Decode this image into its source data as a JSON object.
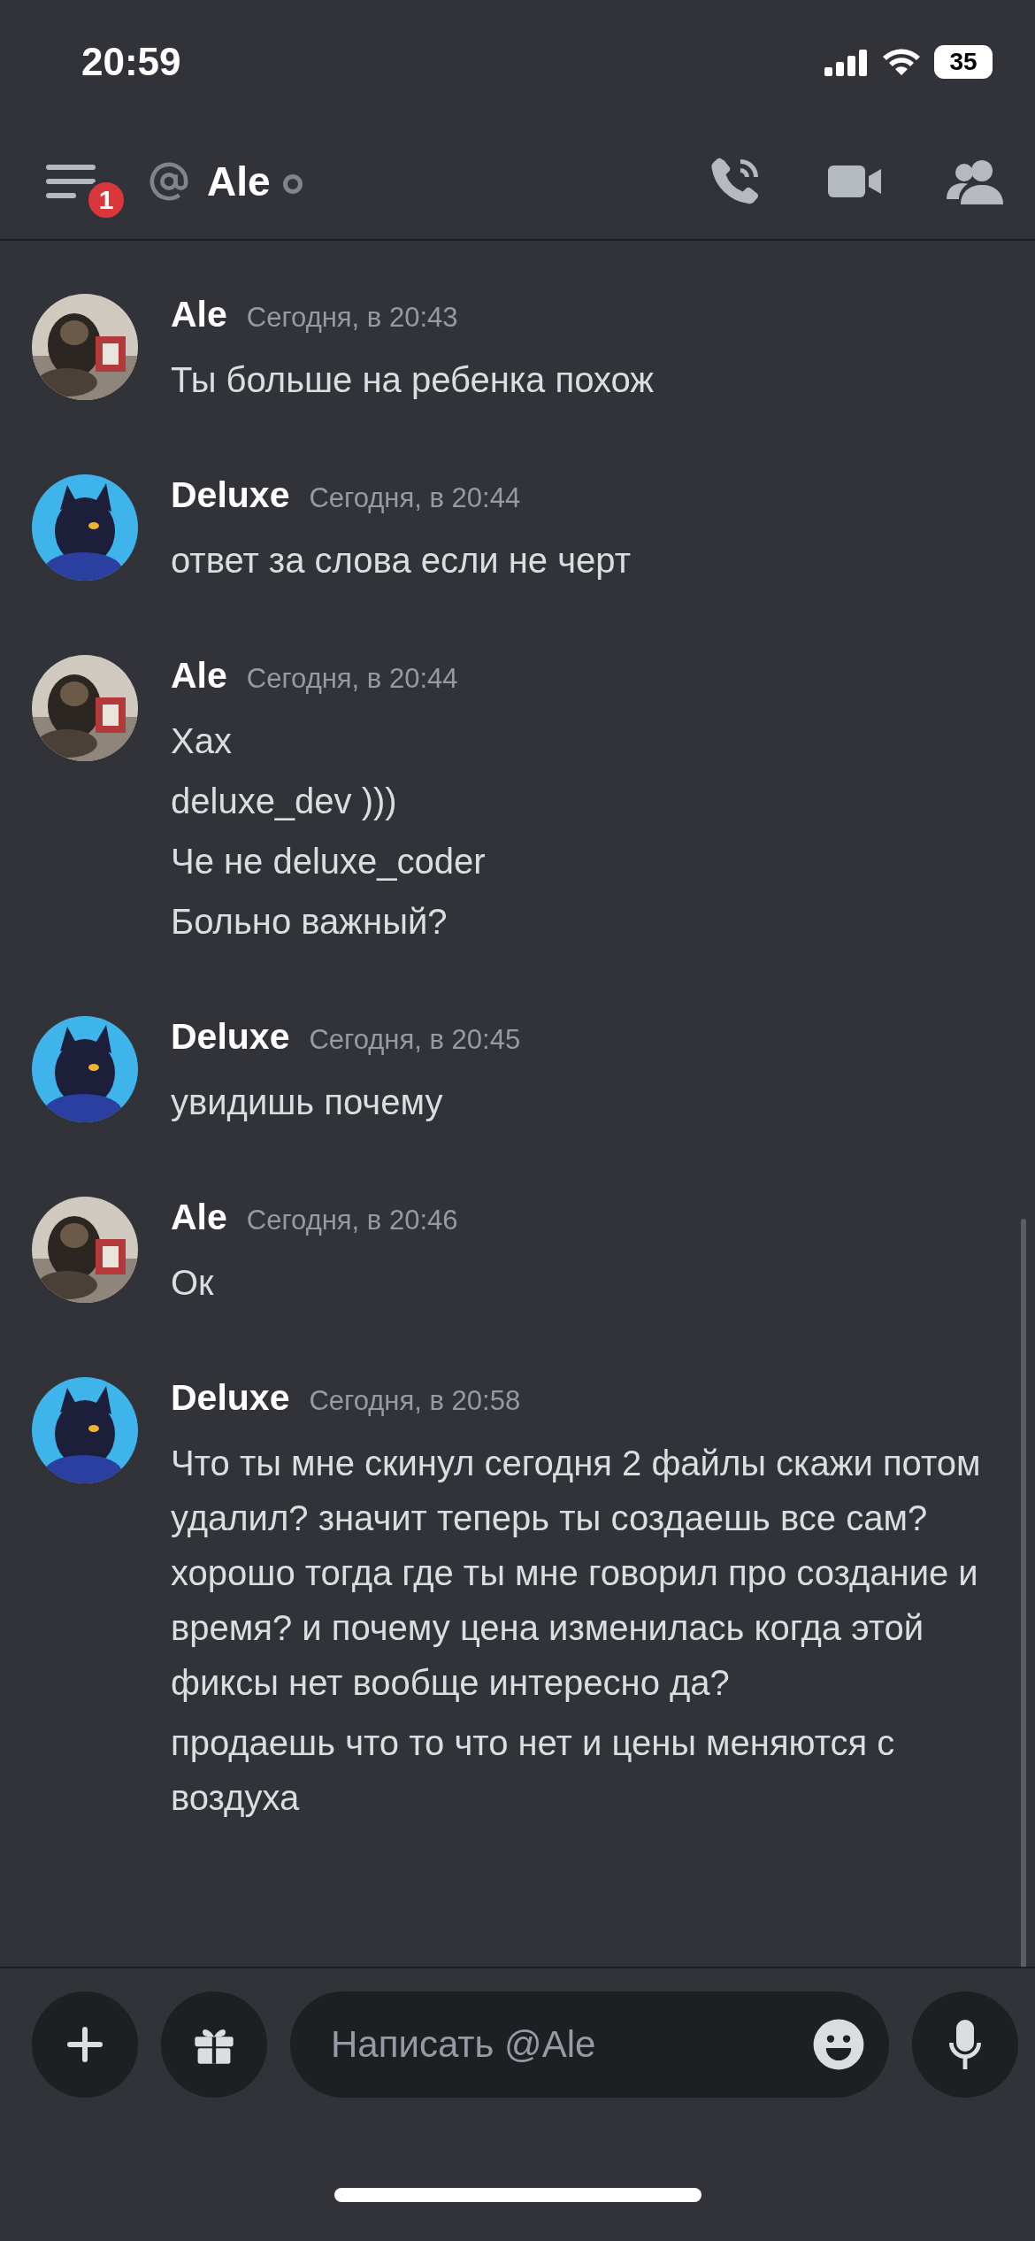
{
  "status_bar": {
    "time": "20:59",
    "battery": "35"
  },
  "header": {
    "menu_badge": "1",
    "channel_name": "Ale",
    "online": false
  },
  "messages": [
    {
      "author": "Ale",
      "time": "Сегодня, в 20:43",
      "avatar": {
        "kind": "picture"
      },
      "lines": [
        "Ты больше на ребенка похож"
      ]
    },
    {
      "author": "Deluxe",
      "time": "Сегодня, в 20:44",
      "avatar": {
        "kind": "picture"
      },
      "lines": [
        "ответ за слова если не черт"
      ]
    },
    {
      "author": "Ale",
      "time": "Сегодня, в 20:44",
      "avatar": {
        "kind": "picture"
      },
      "lines": [
        "Хах",
        "deluxe_dev )))",
        "Че не deluxe_coder",
        "Больно важный?"
      ]
    },
    {
      "author": "Deluxe",
      "time": "Сегодня, в 20:45",
      "avatar": {
        "kind": "picture"
      },
      "lines": [
        "увидишь почему"
      ]
    },
    {
      "author": "Ale",
      "time": "Сегодня, в 20:46",
      "avatar": {
        "kind": "picture"
      },
      "lines": [
        "Ок"
      ]
    },
    {
      "author": "Deluxe",
      "time": "Сегодня, в 20:58",
      "avatar": {
        "kind": "picture"
      },
      "lines": [
        "Что ты мне скинул сегодня 2 файлы скажи потом удалил? значит теперь ты создаешь все сам? хорошо тогда где ты мне говорил про создание и время? и почему цена изменилась когда этой фиксы нет вообще интересно да?",
        "продаешь что то что нет и цены меняются с воздуха"
      ]
    }
  ],
  "composer": {
    "placeholder": "Написать @Ale"
  }
}
